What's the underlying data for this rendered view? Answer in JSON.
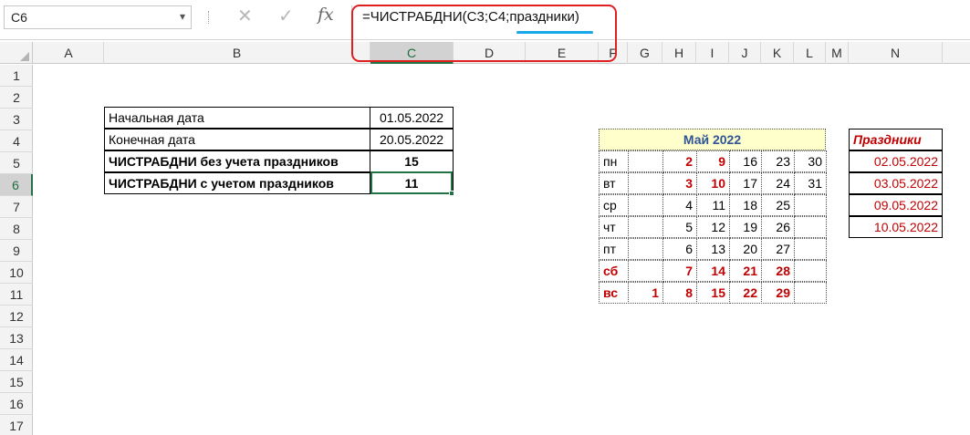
{
  "formula_bar": {
    "name_box": "C6",
    "name_box_arrow": "▾",
    "cancel_icon": "✕",
    "enter_icon": "✓",
    "fx_label": "fx",
    "formula": "=ЧИСТРАБДНИ(C3;C4;праздники)"
  },
  "columns": [
    "A",
    "B",
    "C",
    "D",
    "E",
    "F",
    "G",
    "H",
    "I",
    "J",
    "K",
    "L",
    "M",
    "N"
  ],
  "rows": [
    "1",
    "2",
    "3",
    "4",
    "5",
    "6",
    "7",
    "8",
    "9",
    "10",
    "11",
    "12",
    "13",
    "14",
    "15",
    "16",
    "17"
  ],
  "selected_column": "C",
  "selected_row": "6",
  "main_table": {
    "start_label": "Начальная дата",
    "start_value": "01.05.2022",
    "end_label": "Конечная дата",
    "end_value": "20.05.2022",
    "without_holidays_label": "ЧИСТРАБДНИ без учета праздников",
    "without_holidays_value": "15",
    "with_holidays_label": "ЧИСТРАБДНИ с учетом праздников",
    "with_holidays_value": "11"
  },
  "calendar": {
    "title": "Май 2022",
    "days": [
      {
        "name": "пн",
        "dates": [
          "",
          "2",
          "9",
          "16",
          "23",
          "30"
        ]
      },
      {
        "name": "вт",
        "dates": [
          "",
          "3",
          "10",
          "17",
          "24",
          "31"
        ]
      },
      {
        "name": "ср",
        "dates": [
          "",
          "4",
          "11",
          "18",
          "25",
          ""
        ]
      },
      {
        "name": "чт",
        "dates": [
          "",
          "5",
          "12",
          "19",
          "26",
          ""
        ]
      },
      {
        "name": "пт",
        "dates": [
          "",
          "6",
          "13",
          "20",
          "27",
          ""
        ]
      },
      {
        "name": "сб",
        "dates": [
          "",
          "7",
          "14",
          "21",
          "28",
          ""
        ]
      },
      {
        "name": "вс",
        "dates": [
          "1",
          "8",
          "15",
          "22",
          "29",
          ""
        ]
      }
    ]
  },
  "holidays": {
    "header": "Праздники",
    "dates": [
      "02.05.2022",
      "03.05.2022",
      "09.05.2022",
      "10.05.2022"
    ]
  },
  "colors": {
    "holiday_red": "#c00000",
    "calendar_title": "#2f5496",
    "calendar_title_bg": "#ffffcc",
    "selection_green": "#217346",
    "formula_highlight": "#e02020",
    "underline_blue": "#16a8e8"
  }
}
